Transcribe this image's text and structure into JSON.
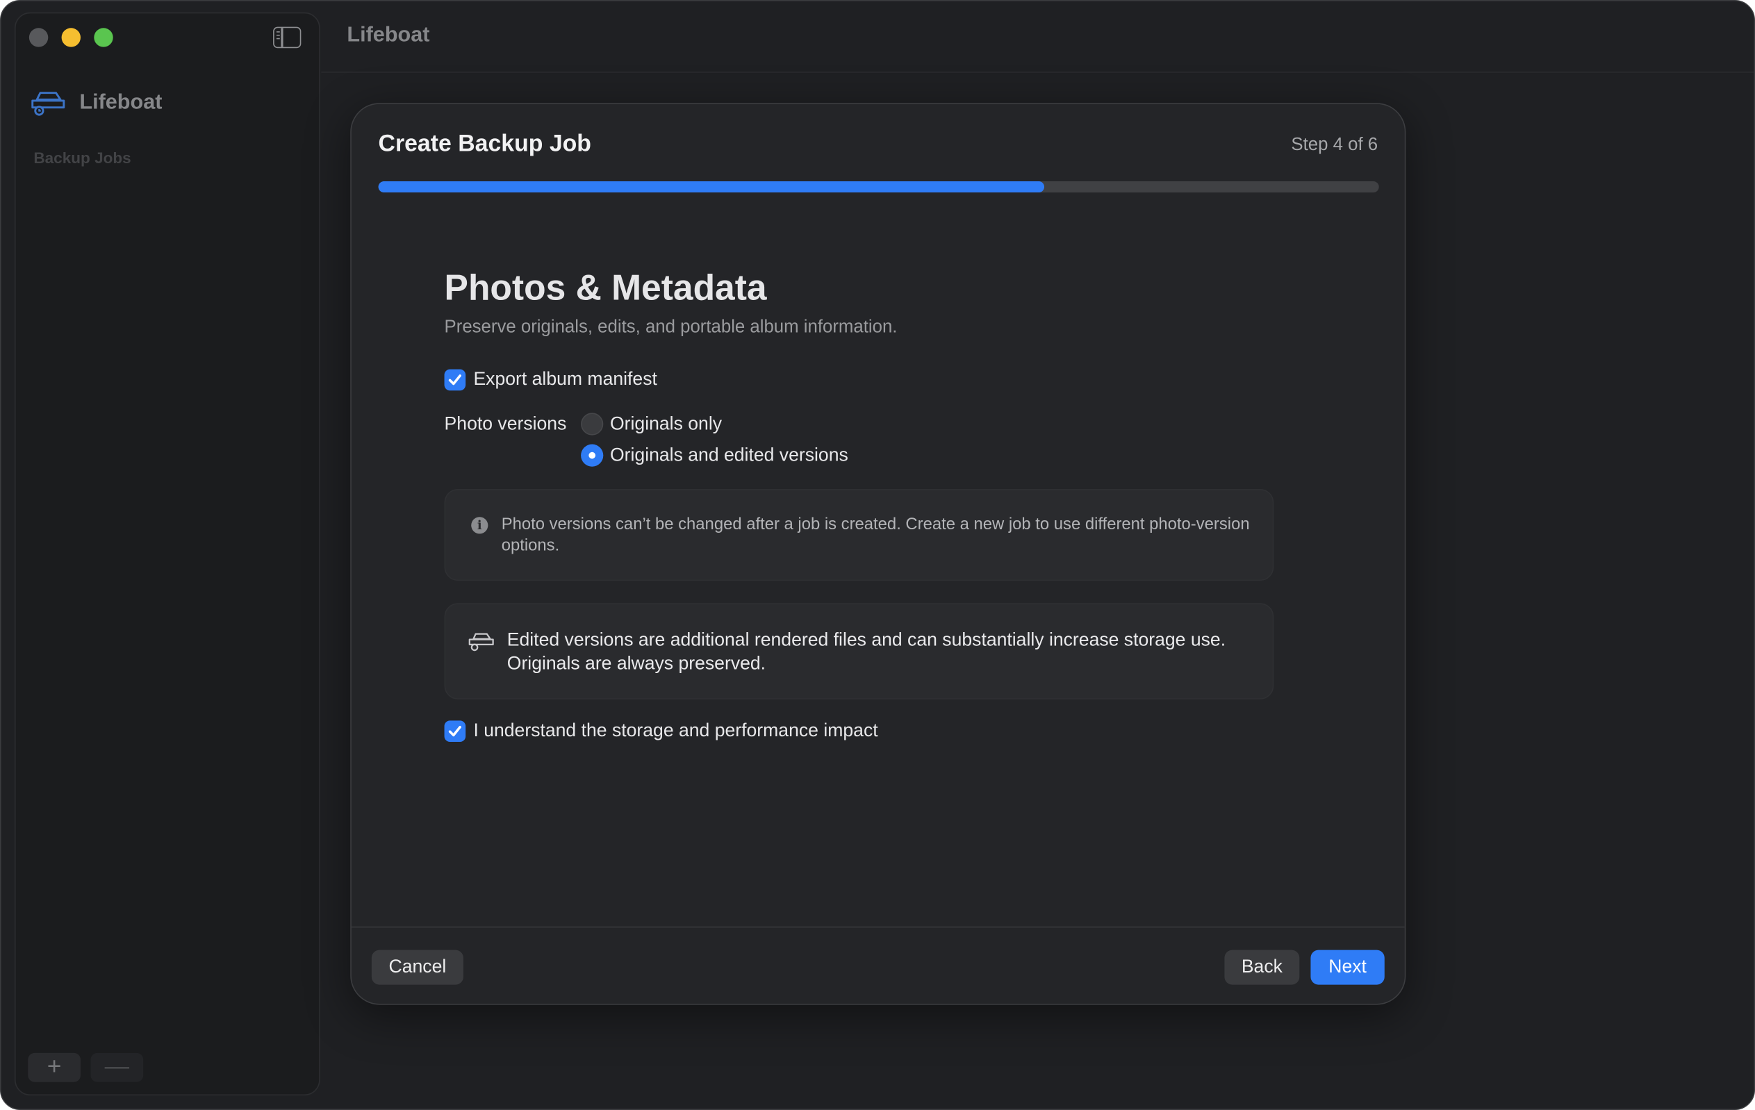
{
  "sidebar": {
    "app_name": "Lifeboat",
    "section_label": "Backup Jobs",
    "add_label": "+",
    "remove_label": "—"
  },
  "main": {
    "title": "Lifeboat"
  },
  "dialog": {
    "title": "Create Backup Job",
    "step": "Step 4 of 6",
    "progress_fraction": 0.665,
    "section_title": "Photos & Metadata",
    "section_subtitle": "Preserve originals, edits, and portable album information.",
    "export_manifest": {
      "label": "Export album manifest",
      "checked": true
    },
    "photo_versions": {
      "label": "Photo versions",
      "options": [
        "Originals only",
        "Originals and edited versions"
      ],
      "selected": "Originals and edited versions"
    },
    "info_note": "Photo versions can’t be changed after a job is created. Create a new job to use different photo-version options.",
    "warning_note": "Edited versions are additional rendered files and can substantially increase storage use. Originals are always preserved.",
    "acknowledge": {
      "label": "I understand the storage and performance impact",
      "checked": true
    },
    "buttons": {
      "cancel": "Cancel",
      "back": "Back",
      "next": "Next"
    }
  },
  "colors": {
    "accent": "#2f7cf6",
    "window_bg": "#1f2023",
    "dialog_bg": "#242528"
  }
}
